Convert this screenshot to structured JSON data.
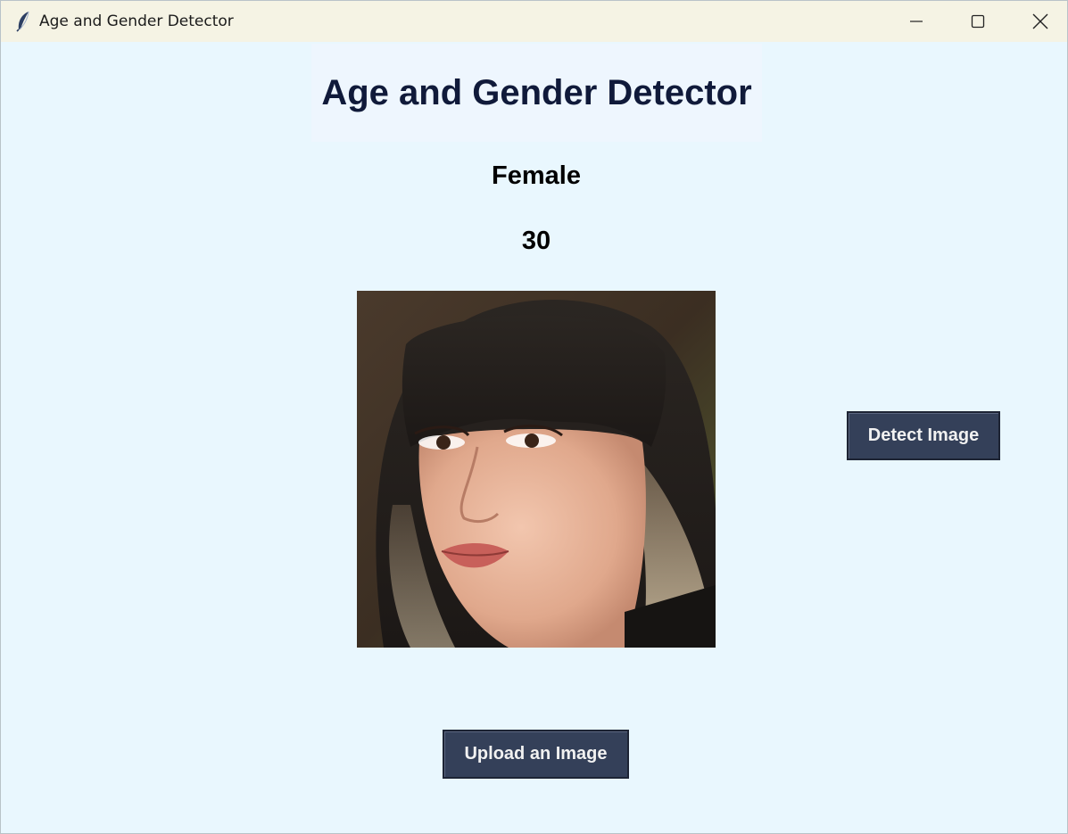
{
  "window": {
    "title": "Age and Gender Detector",
    "background": "#e9f7fe",
    "titlebar_color": "#f5f3e4"
  },
  "main": {
    "heading": "Age and Gender Detector",
    "gender_label": "Female",
    "age_label": "30",
    "photo_icon": "portrait-photo"
  },
  "buttons": {
    "detect_label": "Detect Image",
    "upload_label": "Upload an Image",
    "color": "#344059"
  }
}
